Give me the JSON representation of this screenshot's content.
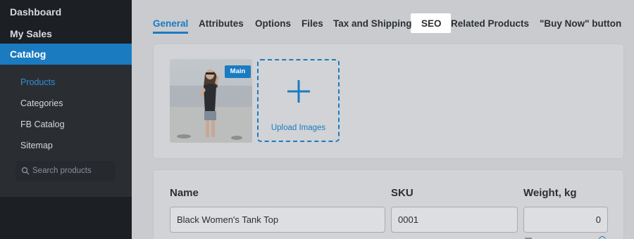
{
  "sidebar": {
    "items": [
      {
        "label": "Dashboard"
      },
      {
        "label": "My Sales"
      },
      {
        "label": "Catalog"
      }
    ],
    "subitems": [
      {
        "label": "Products",
        "active": true
      },
      {
        "label": "Categories"
      },
      {
        "label": "FB Catalog"
      },
      {
        "label": "Sitemap"
      }
    ],
    "search": {
      "placeholder": "Search products",
      "icon": "search-icon"
    }
  },
  "tabs": [
    {
      "label": "General",
      "active": true
    },
    {
      "label": "Attributes"
    },
    {
      "label": "Options"
    },
    {
      "label": "Files"
    },
    {
      "label": "Tax and Shipping"
    },
    {
      "label": "SEO",
      "highlighted": true
    },
    {
      "label": "Related Products"
    },
    {
      "label": "\"Buy Now\" button"
    }
  ],
  "images": {
    "main_badge": "Main",
    "upload_label": "Upload Images",
    "upload_icon": "plus-icon"
  },
  "fields": {
    "name": {
      "label": "Name",
      "value": "Black Women's Tank Top"
    },
    "sku": {
      "label": "SKU",
      "value": "0001"
    },
    "weight": {
      "label": "Weight, kg",
      "value": "0"
    }
  },
  "colors": {
    "accent": "#1b7bc1",
    "sidebar_bg": "#1c1f23",
    "overlay_bg": "#c9cbce"
  }
}
